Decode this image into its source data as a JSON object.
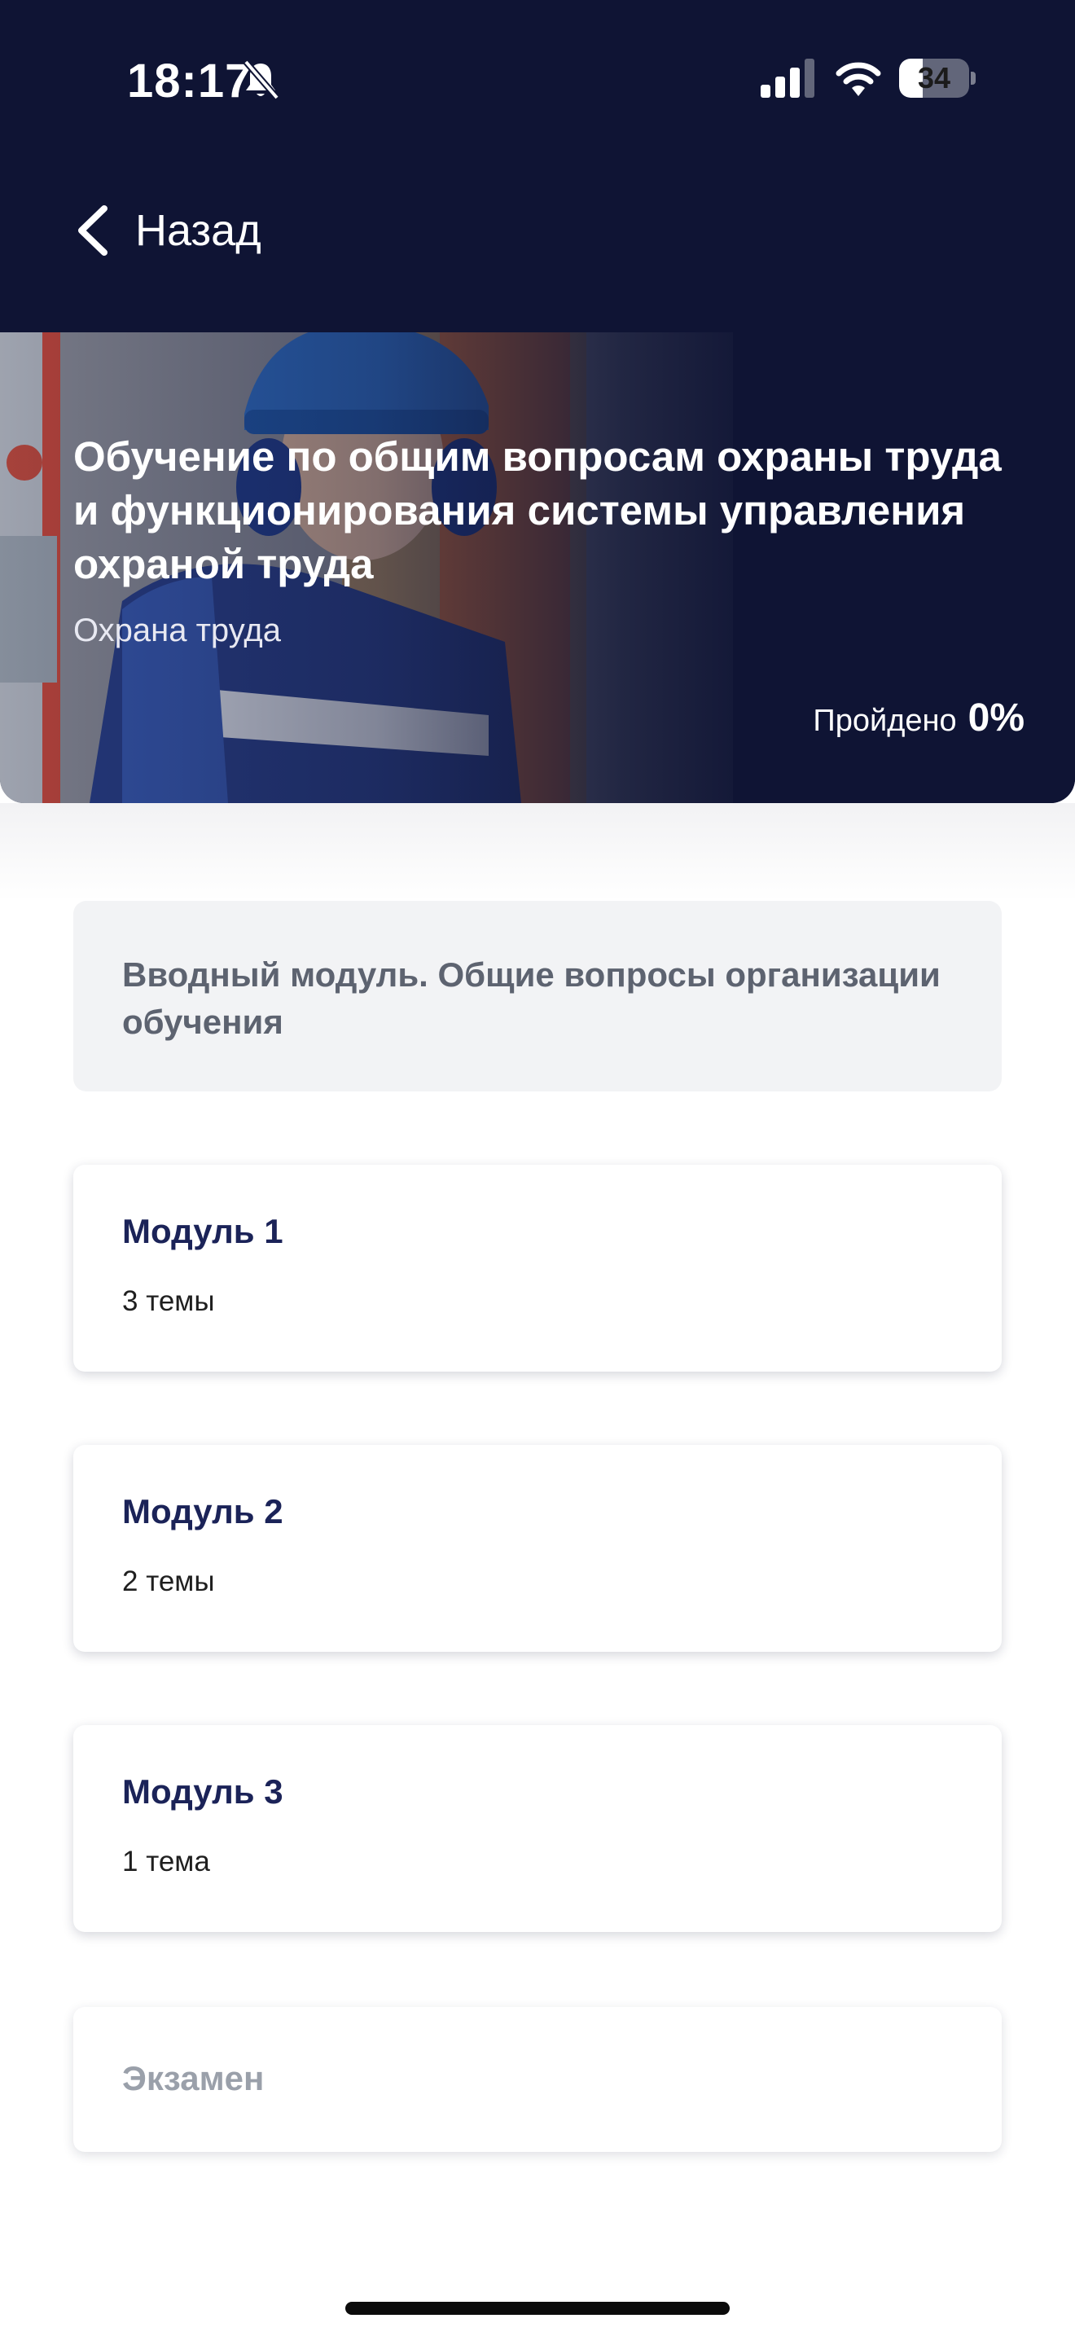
{
  "status_bar": {
    "time": "18:17",
    "battery_level": "34",
    "battery_fraction": 0.34,
    "icons": [
      "bell-muted-icon",
      "cellular-signal-icon",
      "wifi-icon",
      "battery-icon"
    ]
  },
  "nav": {
    "back_label": "Назад",
    "back_icon": "chevron-left-icon"
  },
  "course": {
    "title": "Обучение по общим вопросам охраны труда и функционирования системы управления охраной труда",
    "category": "Охрана труда",
    "progress_label": "Пройдено",
    "progress_value": "0%"
  },
  "intro_module": {
    "title": "Вводный модуль. Общие вопросы организации обучения"
  },
  "modules": [
    {
      "title": "Модуль 1",
      "topics": "3 темы"
    },
    {
      "title": "Модуль 2",
      "topics": "2 темы"
    },
    {
      "title": "Модуль 3",
      "topics": "1 тема"
    }
  ],
  "exam": {
    "title": "Экзамен"
  },
  "colors": {
    "header_bg": "#0f1434",
    "module_title": "#1b2358",
    "intro_bg": "#f2f3f5",
    "disabled_text": "#9aa0aa"
  }
}
